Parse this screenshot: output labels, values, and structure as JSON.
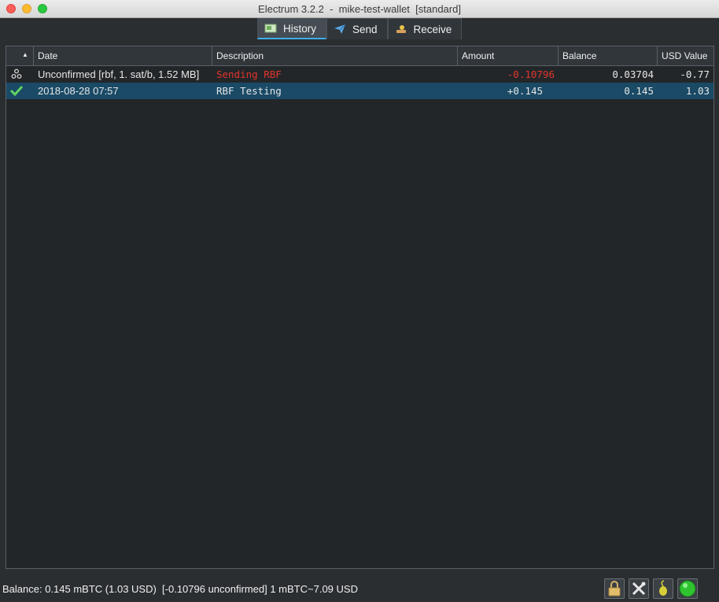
{
  "window": {
    "title": "Electrum 3.2.2  -  mike-test-wallet  [standard]"
  },
  "tabs": [
    {
      "label": "History",
      "icon": "history-icon",
      "active": true
    },
    {
      "label": "Send",
      "icon": "send-paper-plane-icon",
      "active": false
    },
    {
      "label": "Receive",
      "icon": "receive-hand-icon",
      "active": false
    }
  ],
  "history": {
    "columns": [
      "",
      "Date",
      "Description",
      "Amount",
      "Balance",
      "USD Value"
    ],
    "sort_indicator": "sort-ascending-icon",
    "rows": [
      {
        "status_icon": "unconfirmed-icon",
        "date": "Unconfirmed [rbf, 1. sat/b, 1.52 MB]",
        "description": "Sending RBF",
        "amount": "-0.10796",
        "balance": "0.03704",
        "usd_value": "-0.77"
      },
      {
        "status_icon": "confirmed-check-icon",
        "date": "2018-08-28 07:57",
        "description": "RBF Testing",
        "amount": "+0.145",
        "balance": "0.145",
        "usd_value": "1.03"
      }
    ]
  },
  "status": {
    "text": "Balance: 0.145 mBTC (1.03 USD)  [-0.10796 unconfirmed] 1 mBTC~7.09 USD",
    "buttons": [
      "lock-icon",
      "tools-icon",
      "seed-icon",
      "network-status-icon"
    ]
  },
  "colors": {
    "negative": "#e0352b",
    "selection": "#1a4a66",
    "confirmed": "#5fd35f",
    "network_ok": "#2fc42f"
  }
}
